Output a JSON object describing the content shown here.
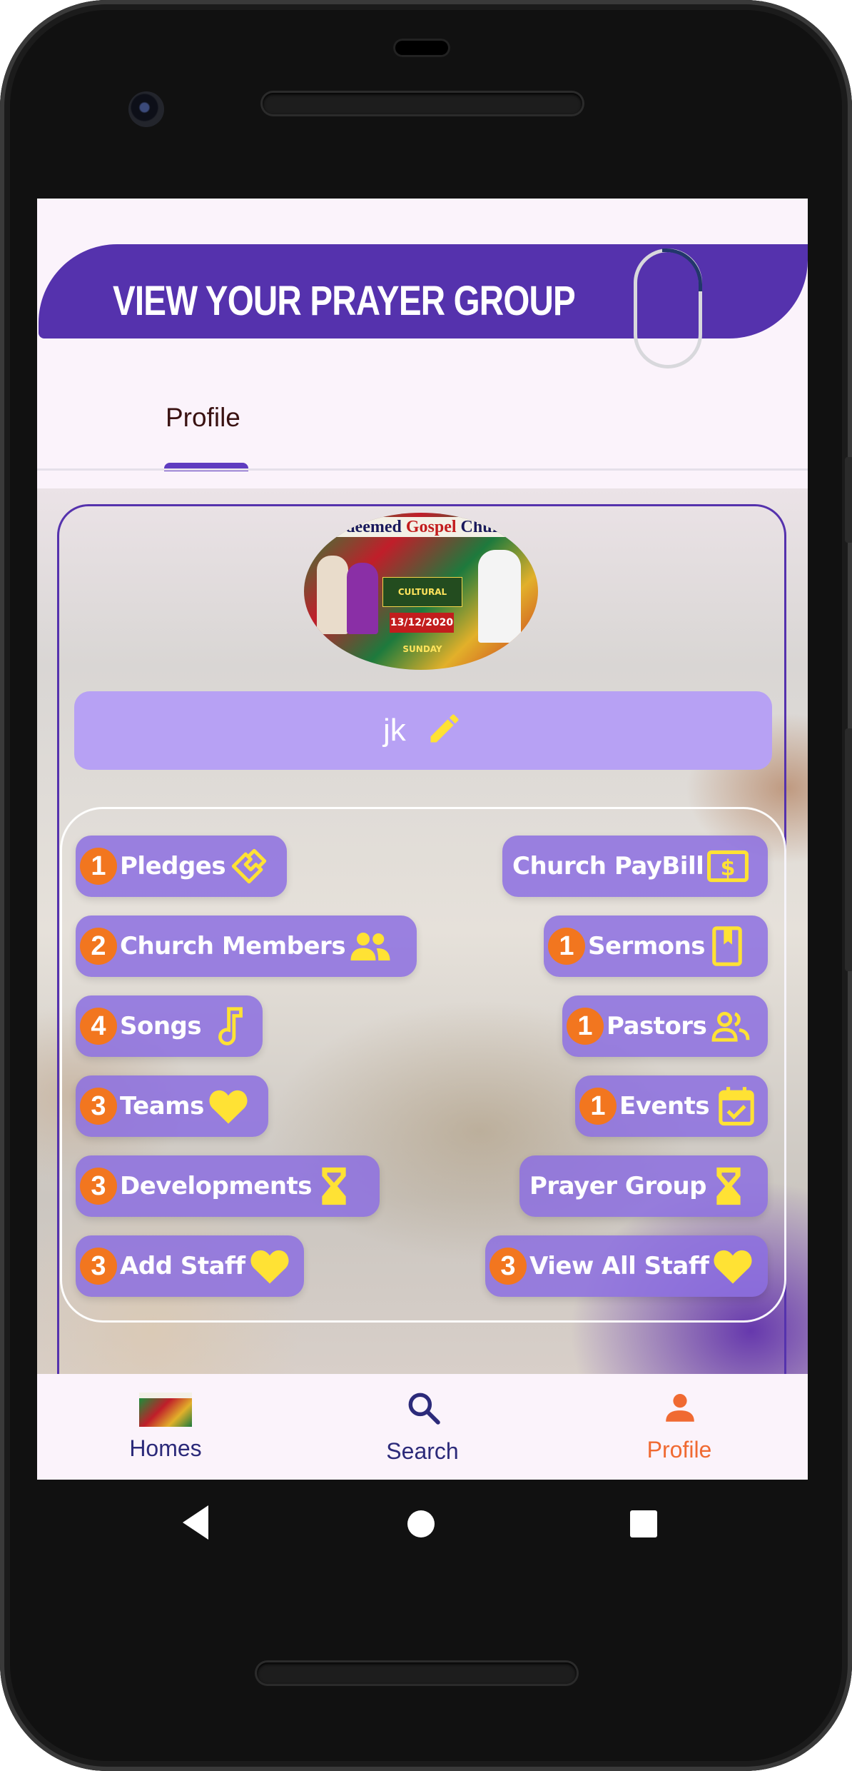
{
  "header": {
    "title": "VIEW YOUR PRAYER GROUP"
  },
  "tabs": [
    {
      "label": "Profile"
    }
  ],
  "profile_image": {
    "banner_pre": "Redeemed ",
    "banner_red": "Gospel",
    "banner_post": " Church",
    "event": "CULTURAL WORSHIP SUNDAY",
    "date": "13/12/2020"
  },
  "profile": {
    "name": "jk"
  },
  "buttons_left": [
    {
      "badge": "1",
      "label": "Pledges",
      "icon": "handshake-icon"
    },
    {
      "badge": "2",
      "label": "Church Members",
      "icon": "people-icon"
    },
    {
      "badge": "4",
      "label": "Songs",
      "icon": "music-note-icon"
    },
    {
      "badge": "3",
      "label": "Teams",
      "icon": "heart-icon"
    },
    {
      "badge": "3",
      "label": "Developments",
      "icon": "hourglass-icon"
    },
    {
      "badge": "3",
      "label": "Add Staff",
      "icon": "heart-icon"
    }
  ],
  "buttons_right": [
    {
      "badge": "",
      "label": "Church PayBill",
      "icon": "dollar-bill-icon"
    },
    {
      "badge": "1",
      "label": "Sermons",
      "icon": "bookmark-book-icon"
    },
    {
      "badge": "1",
      "label": "Pastors",
      "icon": "people-outline-icon"
    },
    {
      "badge": "1",
      "label": "Events",
      "icon": "calendar-check-icon"
    },
    {
      "badge": "",
      "label": "Prayer Group",
      "icon": "hourglass-icon"
    },
    {
      "badge": "3",
      "label": "View All Staff",
      "icon": "heart-icon"
    }
  ],
  "bottom_nav": [
    {
      "label": "Homes",
      "icon": "church-thumbnail",
      "color": "#2c2a7a"
    },
    {
      "label": "Search",
      "icon": "search-icon",
      "color": "#2c2a7a"
    },
    {
      "label": "Profile",
      "icon": "person-icon",
      "color": "#f06a32"
    }
  ],
  "colors": {
    "primary": "#5532ad",
    "badge": "#f2761f",
    "icon_yellow": "#ffe234",
    "active": "#f06a32"
  }
}
